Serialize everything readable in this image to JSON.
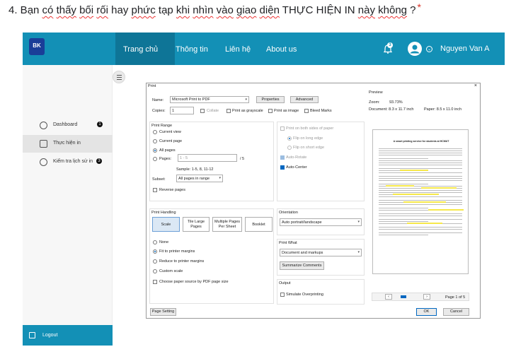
{
  "question": {
    "number": "4.",
    "segments": [
      {
        "t": " Bạn ",
        "sq": false
      },
      {
        "t": "có",
        "sq": true
      },
      {
        "t": " ",
        "sq": false
      },
      {
        "t": "thấy",
        "sq": true
      },
      {
        "t": " ",
        "sq": false
      },
      {
        "t": "bối",
        "sq": true
      },
      {
        "t": " ",
        "sq": false
      },
      {
        "t": "rối",
        "sq": true
      },
      {
        "t": " hay ",
        "sq": false
      },
      {
        "t": "phức",
        "sq": true
      },
      {
        "t": " tạp ",
        "sq": false
      },
      {
        "t": "khi",
        "sq": true
      },
      {
        "t": " ",
        "sq": false
      },
      {
        "t": "nhìn",
        "sq": true
      },
      {
        "t": " ",
        "sq": false
      },
      {
        "t": "vào",
        "sq": true
      },
      {
        "t": " ",
        "sq": false
      },
      {
        "t": "giao",
        "sq": true
      },
      {
        "t": " ",
        "sq": false
      },
      {
        "t": "diện",
        "sq": true
      },
      {
        "t": " THỰC HIỆN IN ",
        "sq": false
      },
      {
        "t": "này",
        "sq": true
      },
      {
        "t": " ",
        "sq": false
      },
      {
        "t": "không",
        "sq": true
      },
      {
        "t": " ?",
        "sq": false
      }
    ],
    "required_mark": "*"
  },
  "app": {
    "logo_text": "BK",
    "nav": [
      "Trang chủ",
      "Thông tin",
      "Liên hệ",
      "About us"
    ],
    "notification_count": "3",
    "user_name": "Nguyen Van A",
    "accent_color": "#1390b6"
  },
  "sidebar": {
    "items": [
      {
        "label": "Dashboard",
        "badge": "1",
        "icon": "dashboard-icon"
      },
      {
        "label": "Thực hiện in",
        "badge": "",
        "icon": "printer-icon"
      },
      {
        "label": "Kiểm tra lịch sử in",
        "badge": "3",
        "icon": "history-icon"
      }
    ],
    "logout": "Logout"
  },
  "print_dialog": {
    "title": "Print",
    "close": "×",
    "name_label": "Name:",
    "name_value": "Microsoft Print to PDF",
    "properties": "Properties",
    "advanced": "Advanced",
    "copies_label": "Copies:",
    "copies_value": "1",
    "collate": "Collate",
    "print_grayscale": "Print as grayscale",
    "print_image": "Print as image",
    "bleed_marks": "Bleed Marks",
    "print_range": {
      "title": "Print Range",
      "current_view": "Current view",
      "current_page": "Current page",
      "all_pages": "All pages",
      "pages": "Pages:",
      "pages_value": "1 - 5",
      "pages_total": "/ 5",
      "sample": "Sample: 1-5, 8, 11-12",
      "subset_label": "Subset:",
      "subset_value": "All pages in range",
      "reverse": "Reverse pages"
    },
    "duplex": {
      "both_sides": "Print on both sides of paper",
      "long_edge": "Flip on long edge",
      "short_edge": "Flip on short edge",
      "auto_rotate": "Auto-Rotate",
      "auto_center": "Auto-Center"
    },
    "print_handling": {
      "title": "Print Handling",
      "tabs": [
        "Scale",
        "Tile Large Pages",
        "Multiple Pages Per Sheet",
        "Booklet"
      ],
      "options": [
        "None",
        "Fit to printer margins",
        "Reduce to printer margins",
        "Custom scale"
      ],
      "choose_paper": "Choose paper source by PDF page size"
    },
    "orientation": {
      "title": "Orientation",
      "value": "Auto portrait/landscape"
    },
    "print_what": {
      "title": "Print What",
      "value": "Document and markups",
      "summarize": "Summarize Comments"
    },
    "output": {
      "title": "Output",
      "simulate": "Simulate Overprinting"
    },
    "preview": {
      "title": "Preview",
      "zoom_label": "Zoom:",
      "zoom_value": "93.73%",
      "document": "Document: 8.3 x 11.7 inch",
      "paper": "Paper: 8.5 x 11.0 inch",
      "doc_title": "A smart printing service for students at HCMUT",
      "page_info": "Page 1 of 5"
    },
    "page_setting": "Page Setting",
    "ok": "OK",
    "cancel": "Cancel"
  }
}
